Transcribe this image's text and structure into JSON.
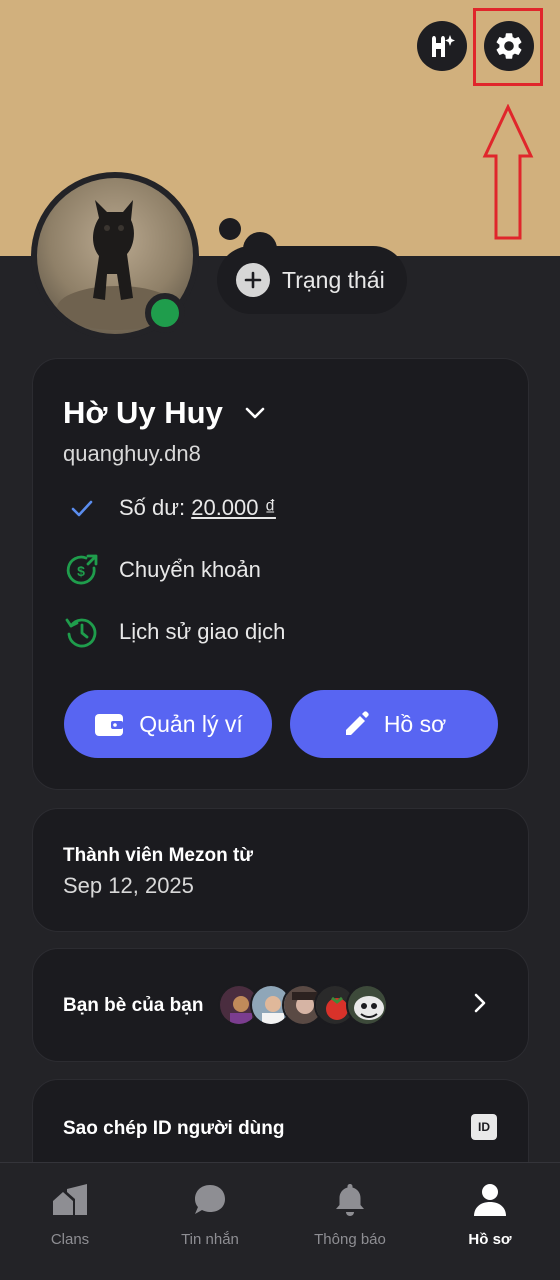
{
  "status": {
    "label": "Trạng thái"
  },
  "profile": {
    "display_name": "Hờ Uy Huy",
    "username": "quanghuy.dn8",
    "balance_label": "Số dư: ",
    "balance_value": "20.000 ₫",
    "transfer_label": "Chuyển khoản",
    "history_label": "Lịch sử giao dịch",
    "wallet_button": "Quản lý ví",
    "profile_button": "Hồ sơ"
  },
  "member": {
    "title": "Thành viên Mezon từ",
    "date": "Sep 12, 2025"
  },
  "friends": {
    "label": "Bạn bè của bạn",
    "avatar_count": 5
  },
  "copy_id": {
    "label": "Sao chép ID người dùng",
    "icon_text": "ID"
  },
  "nav": {
    "items": [
      {
        "label": "Clans",
        "icon": "clans-icon"
      },
      {
        "label": "Tin nhắn",
        "icon": "chat-icon"
      },
      {
        "label": "Thông báo",
        "icon": "bell-icon"
      },
      {
        "label": "Hồ sơ",
        "icon": "user-icon",
        "active": true
      }
    ]
  },
  "colors": {
    "banner": "#d1b07d",
    "accent": "#5865f2",
    "online": "#1f9d4c",
    "highlight": "#e0262b",
    "icon_green": "#1f9d4c"
  }
}
